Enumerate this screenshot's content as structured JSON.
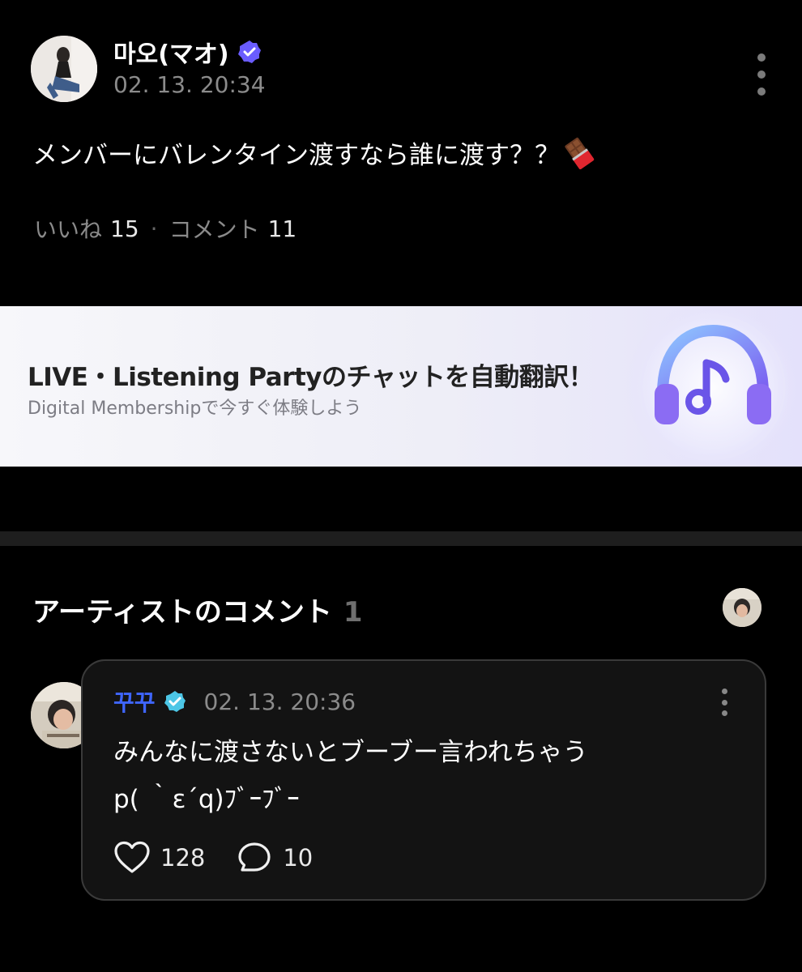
{
  "post": {
    "author": "마오(マオ)",
    "timestamp": "02. 13. 20:34",
    "text": "メンバーにバレンタイン渡すなら誰に渡す？？",
    "likes_label": "いいね",
    "likes_count": "15",
    "separator": "·",
    "comments_label": "コメント",
    "comments_count": "11"
  },
  "banner": {
    "title": "LIVE・Listening Partyのチャットを自動翻訳！",
    "subtitle": "Digital Membershipで今すぐ体験しよう"
  },
  "artist_comments": {
    "title": "アーティストのコメント",
    "count": "1",
    "comment": {
      "author": "꾸꾸",
      "timestamp": "02. 13. 20:36",
      "line1": "みんなに渡さないとブーブー言われちゃう",
      "line2": "p( ｀ε´q)ﾌﾞｰﾌﾞｰ",
      "likes": "128",
      "replies": "10"
    }
  },
  "colors": {
    "background": "#000000",
    "accent_blue": "#3f66ff",
    "badge_purple": "#6a5cff",
    "badge_teal": "#4cc6e6",
    "muted_text": "#8b8b8b"
  },
  "icons": {
    "author_badge": "verified-badge-icon",
    "more": "more-vertical-icon",
    "post_emoji": "chocolate-bar-icon",
    "banner_art": "headphones-music-note-icon",
    "like": "heart-icon",
    "reply": "comment-bubble-icon"
  }
}
